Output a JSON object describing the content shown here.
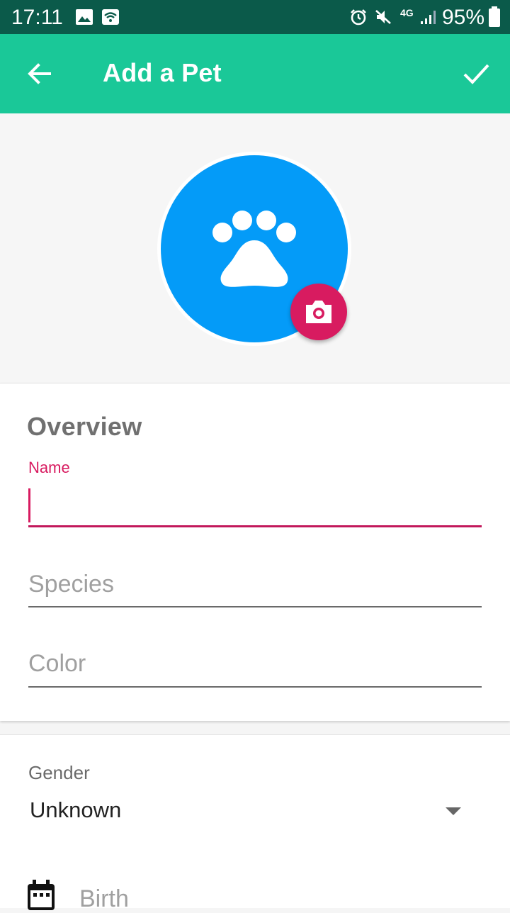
{
  "status_bar": {
    "time": "17:11",
    "battery": "95%",
    "network": "4G"
  },
  "app_bar": {
    "title": "Add a Pet"
  },
  "overview": {
    "section_title": "Overview",
    "name_label": "Name",
    "species_placeholder": "Species",
    "color_placeholder": "Color"
  },
  "details": {
    "gender_label": "Gender",
    "gender_value": "Unknown",
    "birth_placeholder": "Birth"
  },
  "colors": {
    "app_bar": "#1ac898",
    "status_bar": "#0b5a4a",
    "avatar": "#049bf8",
    "accent": "#d81b60"
  }
}
